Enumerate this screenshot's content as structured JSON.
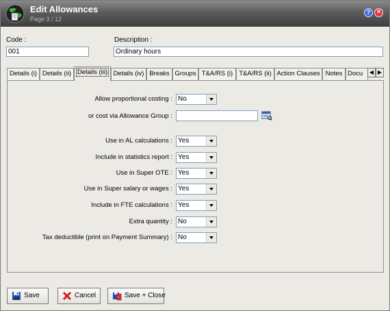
{
  "window": {
    "title": "Edit Allowances",
    "page": "Page 3 / 12"
  },
  "fields": {
    "code_label": "Code :",
    "code_value": "001",
    "description_label": "Description :",
    "description_value": "Ordinary hours"
  },
  "tabs": [
    {
      "label": "Details (i)"
    },
    {
      "label": "Details (ii)"
    },
    {
      "label": "Details (iii)",
      "active": true
    },
    {
      "label": "Details (iv)"
    },
    {
      "label": "Breaks"
    },
    {
      "label": "Groups"
    },
    {
      "label": "T&A/RS (i)"
    },
    {
      "label": "T&A/RS (ii)"
    },
    {
      "label": "Action Clauses"
    },
    {
      "label": "Notes"
    },
    {
      "label": "Docu"
    }
  ],
  "form": {
    "proportional": {
      "label": "Allow proportional costing :",
      "value": "No"
    },
    "allowance_group": {
      "label": "or cost via Allowance Group :",
      "value": ""
    },
    "al_calc": {
      "label": "Use in AL calculations :",
      "value": "Yes"
    },
    "stats_report": {
      "label": "Include in statistics report :",
      "value": "Yes"
    },
    "super_ote": {
      "label": "Use in Super OTE :",
      "value": "Yes"
    },
    "super_salary": {
      "label": "Use in Super salary or wages :",
      "value": "Yes"
    },
    "fte_calc": {
      "label": "Include in FTE calculations :",
      "value": "Yes"
    },
    "extra_quantity": {
      "label": "Extra quantity :",
      "value": "No"
    },
    "tax_deductible": {
      "label": "Tax deductible (print on Payment Summary) :",
      "value": "No"
    }
  },
  "buttons": {
    "save": "Save",
    "cancel": "Cancel",
    "save_close": "Save + Close"
  },
  "colors": {
    "titlebar": "#5c5c5c",
    "window_bg": "#eceae5",
    "save_icon": "#2a4fa8",
    "cancel_icon": "#d02020",
    "help_icon": "#3f6fd8",
    "close_icon": "#d93a3a"
  },
  "icons": {
    "app": "app-globe-icon",
    "help": "help-icon",
    "close": "close-icon",
    "lookup": "lookup-icon",
    "save": "floppy-disk-icon",
    "cancel": "red-x-icon",
    "save_close": "floppy-door-icon",
    "tab_left": "arrow-left-icon",
    "tab_right": "arrow-right-icon"
  }
}
